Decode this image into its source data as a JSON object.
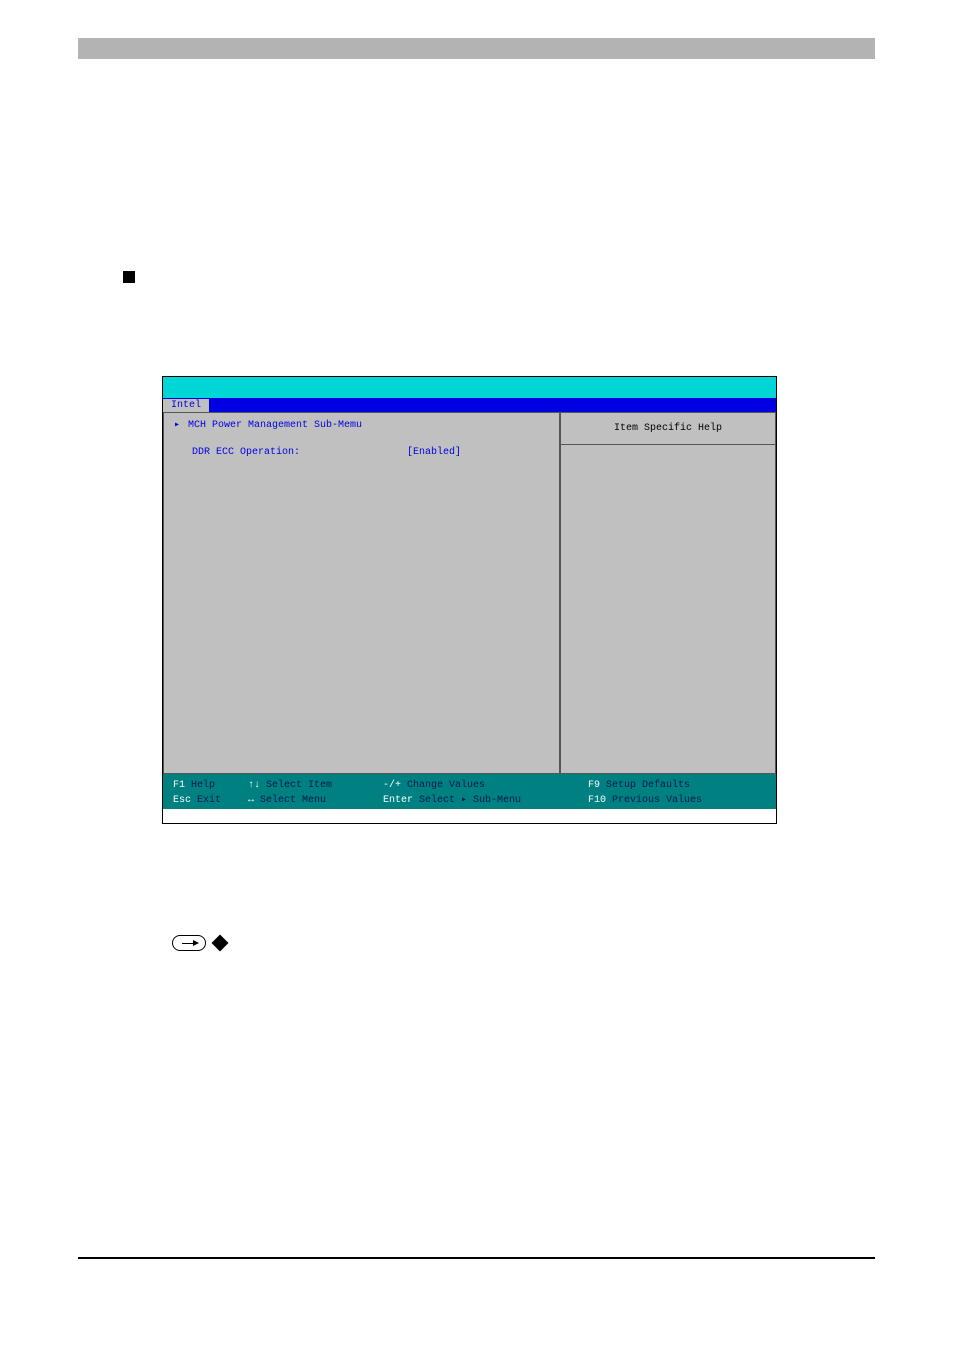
{
  "menu": {
    "tab_active": "Intel"
  },
  "main_panel": {
    "submenu_label": "MCH Power Management Sub-Memu",
    "option_label": "DDR ECC Operation:",
    "option_value": "[Enabled]"
  },
  "help": {
    "header": "Item Specific Help"
  },
  "footer": {
    "f1_key": "F1",
    "f1_label": "Help",
    "updown_key": "↑↓",
    "updown_label": "Select Item",
    "minusplus_key": "-/+",
    "minusplus_label": "Change Values",
    "f9_key": "F9",
    "f9_label": "Setup Defaults",
    "esc_key": "Esc",
    "esc_label": "Exit",
    "leftright_key": "↔",
    "leftright_label": "Select Menu",
    "enter_key": "Enter",
    "enter_label": "Select ▸ Sub-Menu",
    "f10_key": "F10",
    "f10_label": "Previous Values"
  }
}
